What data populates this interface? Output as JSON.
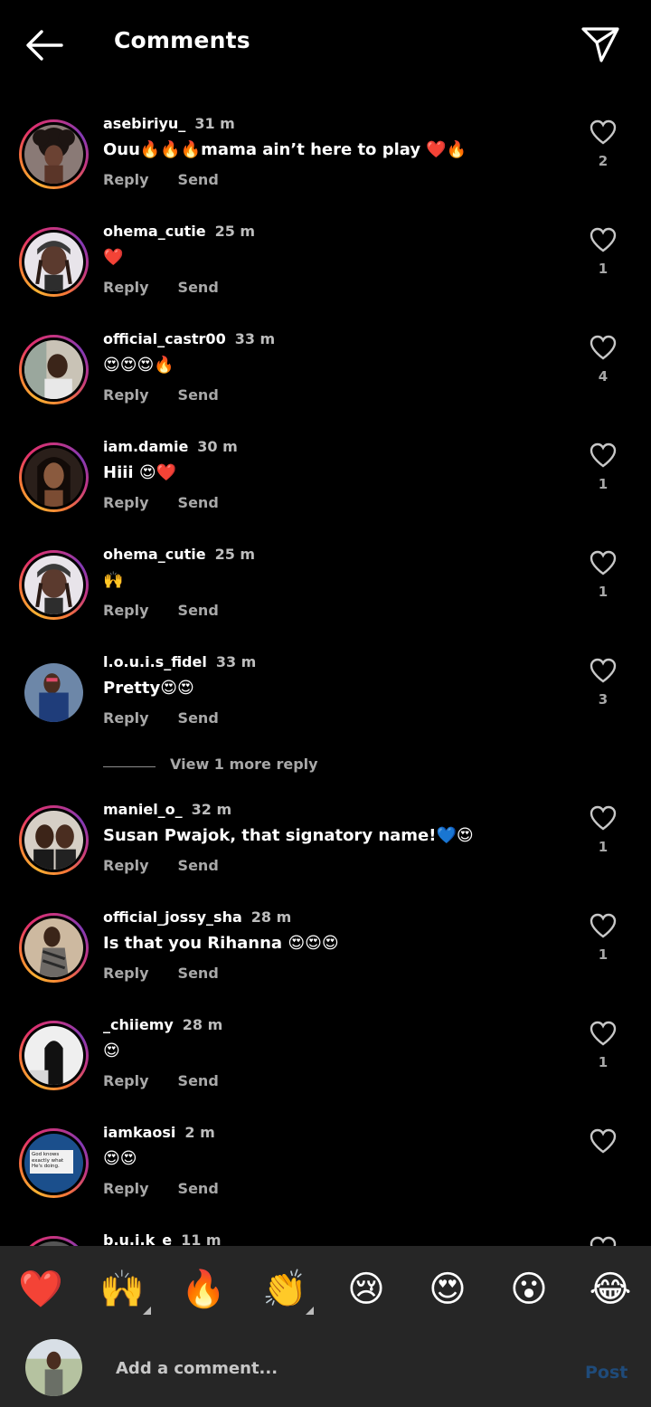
{
  "header": {
    "title": "Comments"
  },
  "comments": [
    {
      "username": "asebiriyu_",
      "time": "31 m",
      "text": "Ouu🔥🔥🔥mama ain’t here to play ❤️🔥",
      "reply": "Reply",
      "send": "Send",
      "likes": "2"
    },
    {
      "username": "ohema_cutie",
      "time": "25 m",
      "text": "❤️",
      "reply": "Reply",
      "send": "Send",
      "likes": "1"
    },
    {
      "username": "official_castr00",
      "time": "33 m",
      "text": "😍😍😍🔥",
      "reply": "Reply",
      "send": "Send",
      "likes": "4"
    },
    {
      "username": "iam.damie",
      "time": "30 m",
      "text": "Hiii 😍❤️",
      "reply": "Reply",
      "send": "Send",
      "likes": "1"
    },
    {
      "username": "ohema_cutie",
      "time": "25 m",
      "text": "🙌",
      "reply": "Reply",
      "send": "Send",
      "likes": "1"
    },
    {
      "username": "l.o.u.i.s_fidel",
      "time": "33 m",
      "text": "Pretty😍😍",
      "reply": "Reply",
      "send": "Send",
      "likes": "3"
    },
    {
      "username": "maniel_o_",
      "time": "32 m",
      "text": "Susan Pwajok, that signatory name!💙😍",
      "reply": "Reply",
      "send": "Send",
      "likes": "1"
    },
    {
      "username": "official_jossy_sha",
      "time": "28 m",
      "text": "Is that you Rihanna 😍😍😍",
      "reply": "Reply",
      "send": "Send",
      "likes": "1"
    },
    {
      "username": "_chiiemy",
      "time": "28 m",
      "text": "😍",
      "reply": "Reply",
      "send": "Send",
      "likes": "1"
    },
    {
      "username": "iamkaosi",
      "time": "2 m",
      "text": "😍😍",
      "reply": "Reply",
      "send": "Send",
      "likes": ""
    },
    {
      "username": "b.u.i.k_e",
      "time": "11 m",
      "text": "",
      "reply": "",
      "send": "",
      "likes": ""
    }
  ],
  "view_more": {
    "label": "View 1 more reply"
  },
  "iamkaosi_avatar_text": "God knows exactly what He's doing.",
  "emoji_bar": [
    "❤️",
    "🙌",
    "🔥",
    "👏",
    "😢",
    "😍",
    "😮",
    "😂"
  ],
  "composer": {
    "placeholder": "Add a comment...",
    "post_label": "Post"
  },
  "colors": {
    "background": "#000000",
    "bar": "#262626",
    "post": "#1f4b7a"
  }
}
